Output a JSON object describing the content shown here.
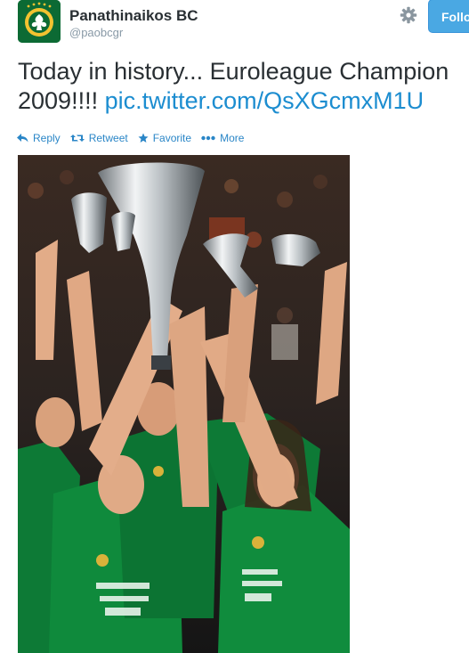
{
  "header": {
    "display_name": "Panathinaikos BC",
    "screen_name": "@paobcgr",
    "follow_label": "Follo"
  },
  "tweet": {
    "text_line1": "Today in history... Euroleague Champion",
    "text_line2_prefix": "2009!!!! ",
    "link_text": "pic.twitter.com/QsXGcmxM1U"
  },
  "actions": [
    {
      "label": "Reply",
      "icon": "reply-icon"
    },
    {
      "label": "Retweet",
      "icon": "retweet-icon"
    },
    {
      "label": "Favorite",
      "icon": "star-icon"
    },
    {
      "label": "More",
      "icon": "more-dots-icon"
    }
  ],
  "colors": {
    "link": "#1c8dd0",
    "action": "#2a86c7",
    "follow_button": "#4aa8e3",
    "team_green": "#0c6a34"
  }
}
